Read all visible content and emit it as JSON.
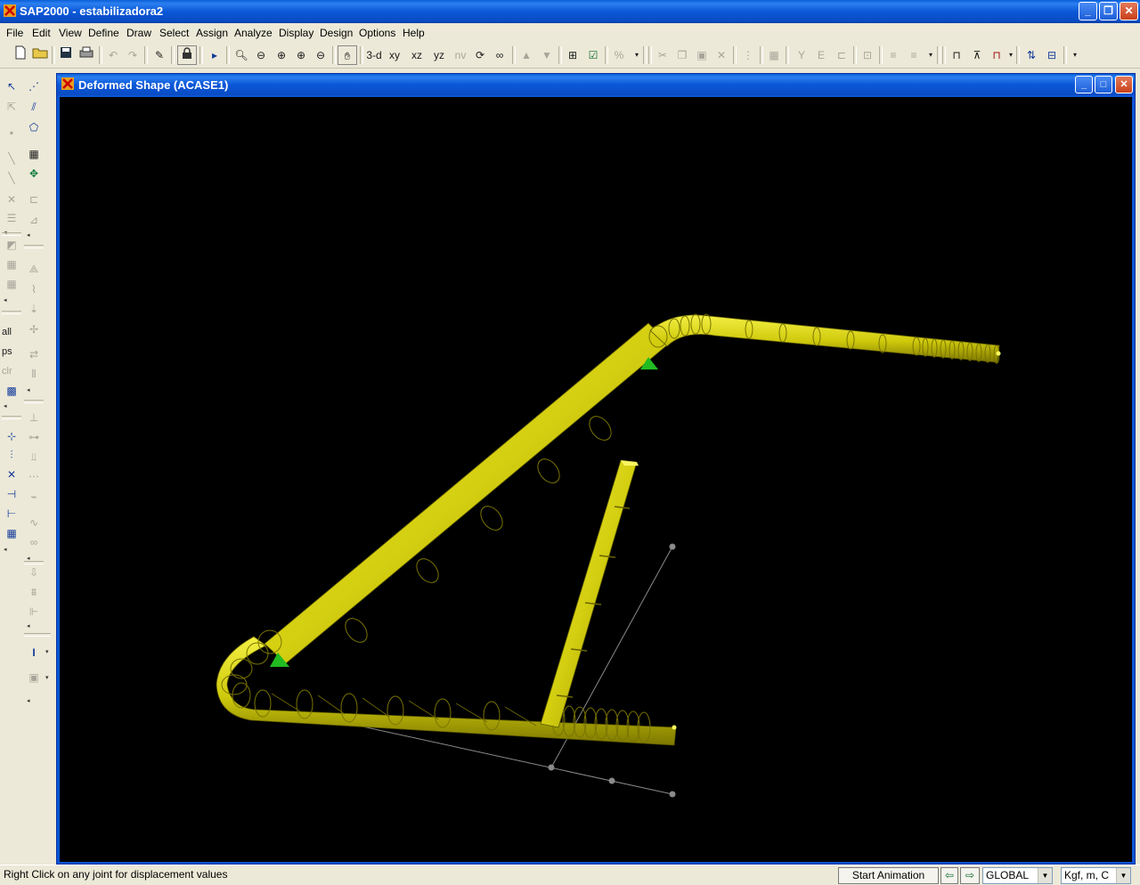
{
  "app": {
    "title": "SAP2000 - estabilizadora2",
    "window_controls": {
      "minimize": "_",
      "restore": "❐",
      "close": "✕"
    }
  },
  "menu": [
    "File",
    "Edit",
    "View",
    "Define",
    "Draw",
    "Select",
    "Assign",
    "Analyze",
    "Display",
    "Design",
    "Options",
    "Help"
  ],
  "toolbar": {
    "view_3d": "3-d",
    "view_xy": "xy",
    "view_xz": "xz",
    "view_yz": "yz",
    "view_nv": "nv"
  },
  "left_tools": {
    "all": "all",
    "ps": "ps",
    "clr": "clr"
  },
  "child_window": {
    "title": "Deformed Shape (ACASE1)"
  },
  "status": {
    "message": "Right Click on any joint for displacement values",
    "start_animation": "Start Animation",
    "coord_system": "GLOBAL",
    "units": "Kgf, m, C"
  },
  "colors": {
    "structure": "#d4d000",
    "support": "#22bb22",
    "undeformed": "#8a8a8a",
    "titlebar": "#0b58d8"
  }
}
